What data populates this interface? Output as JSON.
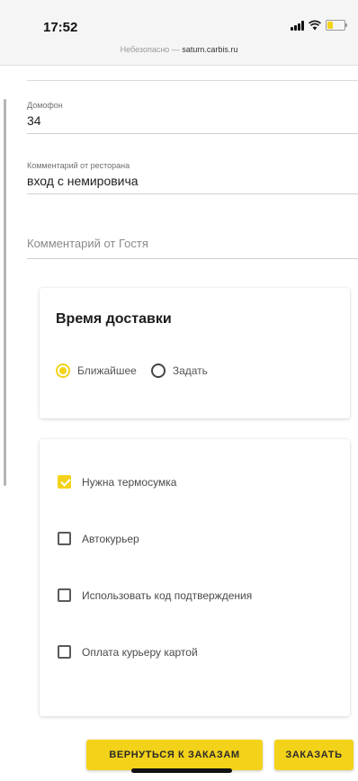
{
  "status_bar": {
    "time": "17:52",
    "url_prefix": "Небезопасно — ",
    "url_domain": "saturn.carbis.ru"
  },
  "form": {
    "intercom": {
      "label": "Домофон",
      "value": "34"
    },
    "restaurant_comment": {
      "label": "Комментарий от ресторана",
      "value": "вход с немировича"
    },
    "guest_comment": {
      "placeholder": "Комментарий от Гостя"
    }
  },
  "delivery_time": {
    "title": "Время доставки",
    "options": [
      {
        "label": "Ближайшее",
        "selected": true
      },
      {
        "label": "Задать",
        "selected": false
      }
    ]
  },
  "options": [
    {
      "label": "Нужна термосумка",
      "checked": true
    },
    {
      "label": "Автокурьер",
      "checked": false
    },
    {
      "label": "Использовать код подтверждения",
      "checked": false
    },
    {
      "label": "Оплата курьеру картой",
      "checked": false
    }
  ],
  "actions": {
    "back_label": "ВЕРНУТЬСЯ К ЗАКАЗАМ",
    "order_label": "ЗАКАЗАТЬ"
  },
  "colors": {
    "accent": "#f3d21a"
  }
}
